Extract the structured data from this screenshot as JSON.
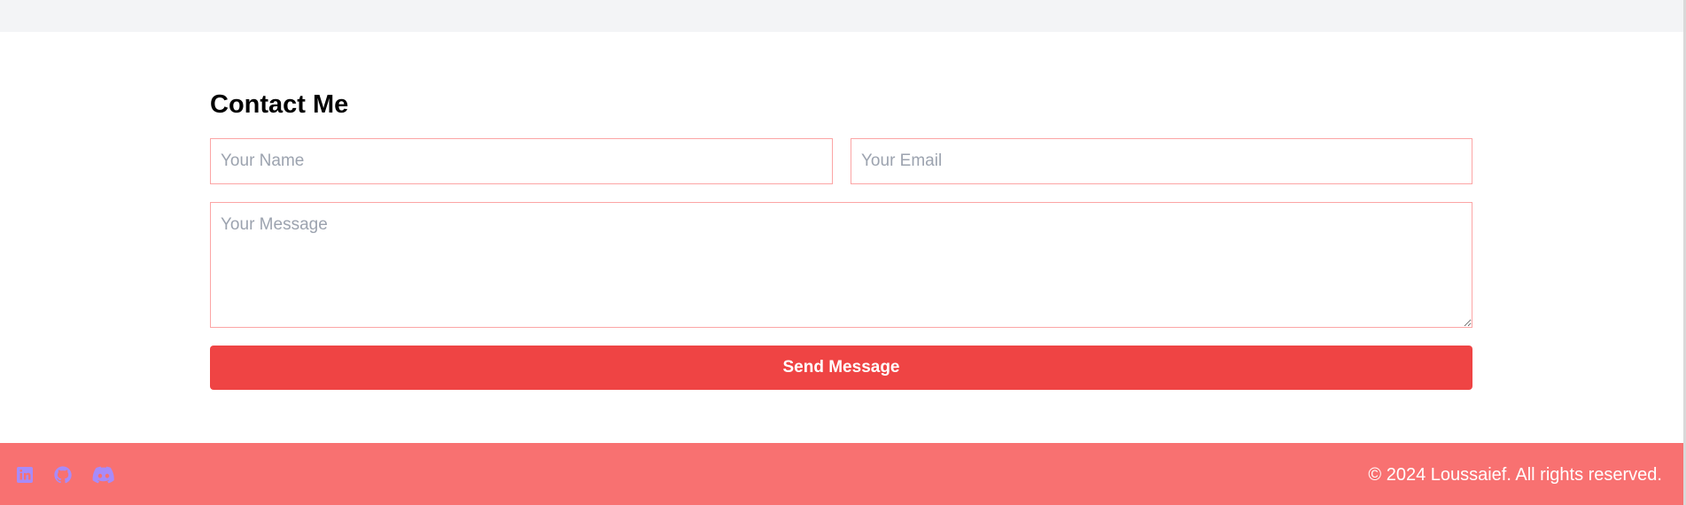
{
  "contact": {
    "title": "Contact Me",
    "name_placeholder": "Your Name",
    "email_placeholder": "Your Email",
    "message_placeholder": "Your Message",
    "send_label": "Send Message"
  },
  "footer": {
    "social_icons": [
      "linkedin-icon",
      "github-icon",
      "discord-icon"
    ],
    "copyright": "© 2024 Loussaief. All rights reserved."
  },
  "colors": {
    "accent": "#ef4444",
    "footer_background": "#f87171",
    "field_border": "#fca5a5",
    "icon_color": "#a78bfa",
    "top_band": "#f3f4f6"
  }
}
